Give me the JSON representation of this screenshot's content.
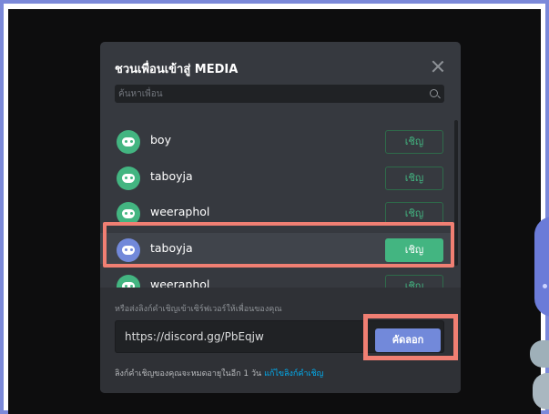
{
  "modal": {
    "title": "ชวนเพื่อนเข้าสู่ MEDIA",
    "search_placeholder": "ค้นหาเพื่อน"
  },
  "friends": [
    {
      "name": "boy",
      "invite_label": "เชิญ",
      "selected": false
    },
    {
      "name": "taboyja",
      "invite_label": "เชิญ",
      "selected": false
    },
    {
      "name": "weeraphol",
      "invite_label": "เชิญ",
      "selected": false
    },
    {
      "name": "taboyja",
      "invite_label": "เชิญ",
      "selected": true
    },
    {
      "name": "weeraphol",
      "invite_label": "เชิญ",
      "selected": false
    }
  ],
  "footer": {
    "label": "หรือส่งลิงก์คำเชิญเข้าเซิร์ฟเวอร์ให้เพื่อนของคุณ",
    "invite_link": "https://discord.gg/PbEqjw",
    "copy_label": "คัดลอก",
    "expire_text": "ลิงก์คำเชิญของคุณจะหมดอายุในอีก 1 วัน",
    "edit_link_label": "แก้ไขลิงก์คำเชิญ"
  },
  "colors": {
    "accent": "#7289da",
    "green": "#43b581",
    "highlight": "#f07f73"
  }
}
